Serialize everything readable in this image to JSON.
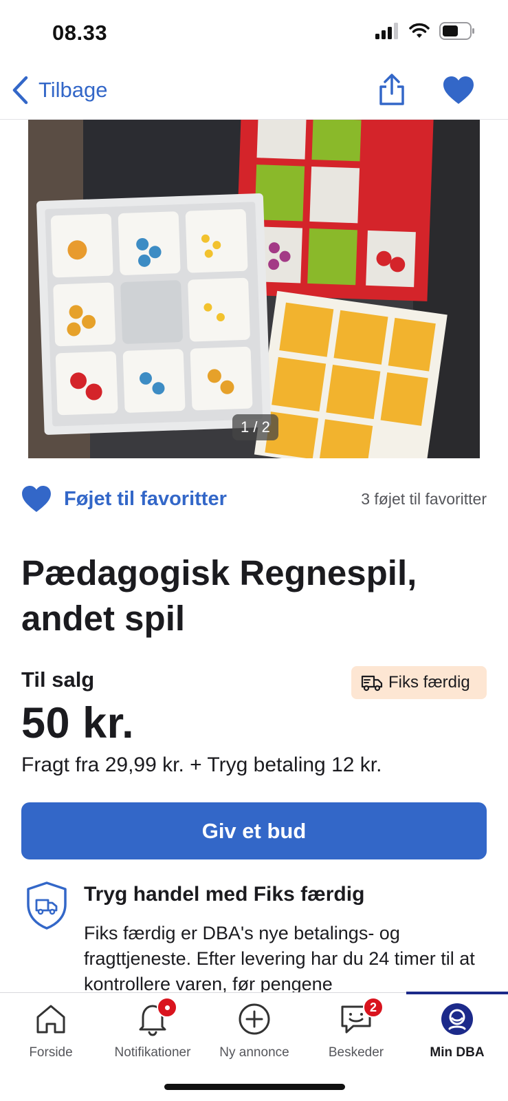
{
  "status": {
    "time": "08.33"
  },
  "nav": {
    "back_label": "Tilbage"
  },
  "photo": {
    "counter": "1 / 2"
  },
  "favorites": {
    "action_label": "Føjet til favoritter",
    "count_text": "3 føjet til favoritter"
  },
  "listing": {
    "title": "Pædagogisk Regnespil, andet spil",
    "sale_label": "Til salg",
    "badge_label": "Fiks færdig",
    "price": "50 kr.",
    "shipping": "Fragt fra 29,99 kr. + Tryg betaling 12 kr.",
    "bid_button": "Giv et bud"
  },
  "info": {
    "title": "Tryg handel med Fiks færdig",
    "body": "Fiks færdig er DBA's nye betalings- og fragttjeneste. Efter levering har du 24 timer til at kontrollere varen, før pengene"
  },
  "tabs": [
    {
      "label": "Forside",
      "icon": "home-icon"
    },
    {
      "label": "Notifikationer",
      "icon": "bell-icon"
    },
    {
      "label": "Ny annonce",
      "icon": "plus-circle-icon"
    },
    {
      "label": "Beskeder",
      "icon": "chat-icon",
      "badge": "2"
    },
    {
      "label": "Min DBA",
      "icon": "profile-icon"
    }
  ],
  "colors": {
    "accent": "#3367c8",
    "badge_bg": "#fde6d3",
    "alert": "#d9141e",
    "active_tab": "#1c2a8a"
  }
}
